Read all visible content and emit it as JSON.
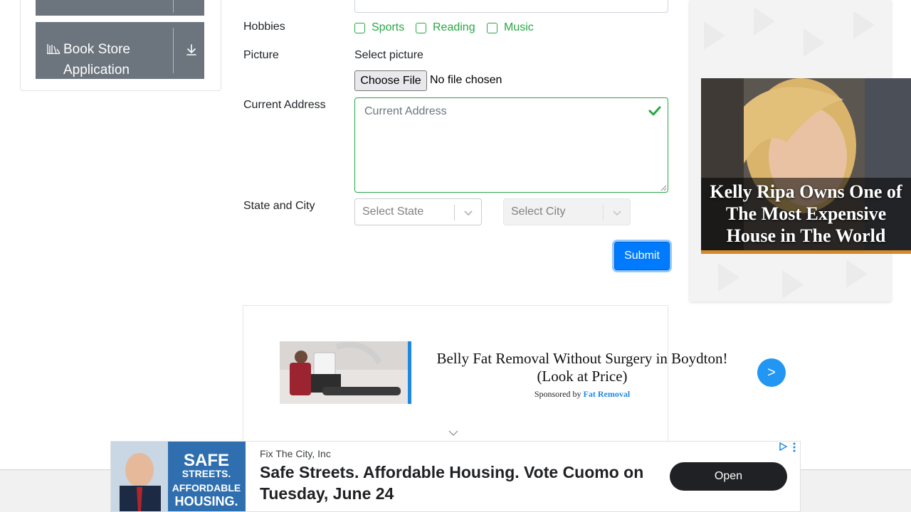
{
  "sidebar": {
    "book_store": {
      "label": "Book Store Application",
      "icon": "book-shelf-icon",
      "action_icon": "download-icon"
    }
  },
  "form": {
    "hobbies": {
      "label": "Hobbies",
      "options": [
        "Sports",
        "Reading",
        "Music"
      ]
    },
    "picture": {
      "label": "Picture",
      "prompt": "Select picture",
      "button_label": "Choose File",
      "status": "No file chosen"
    },
    "address": {
      "label": "Current Address",
      "placeholder": "Current Address",
      "valid_icon": "checkmark-icon"
    },
    "state_city": {
      "label": "State and City",
      "state_placeholder": "Select State",
      "city_placeholder": "Select City"
    },
    "submit_label": "Submit"
  },
  "native_ad": {
    "title": "Belly Fat Removal Without Surgery in Boydton! (Look at Price)",
    "sponsored_prefix": "Sponsored by",
    "sponsor": "Fat Removal",
    "arrow_label": ">"
  },
  "right_ad": {
    "caption": "Kelly Ripa Owns One of The Most Expensive House in The World"
  },
  "banner_ad": {
    "advertiser": "Fix The City, Inc",
    "headline": "Safe Streets. Affordable Housing. Vote Cuomo on Tuesday, June 24",
    "open_label": "Open",
    "image_text": [
      "SAFE",
      "STREETS.",
      "AFFORDABLE",
      "HOUSING."
    ]
  },
  "colors": {
    "accent_blue": "#007bff",
    "valid_green": "#28a745",
    "sidebar_gray": "#6c757d"
  }
}
